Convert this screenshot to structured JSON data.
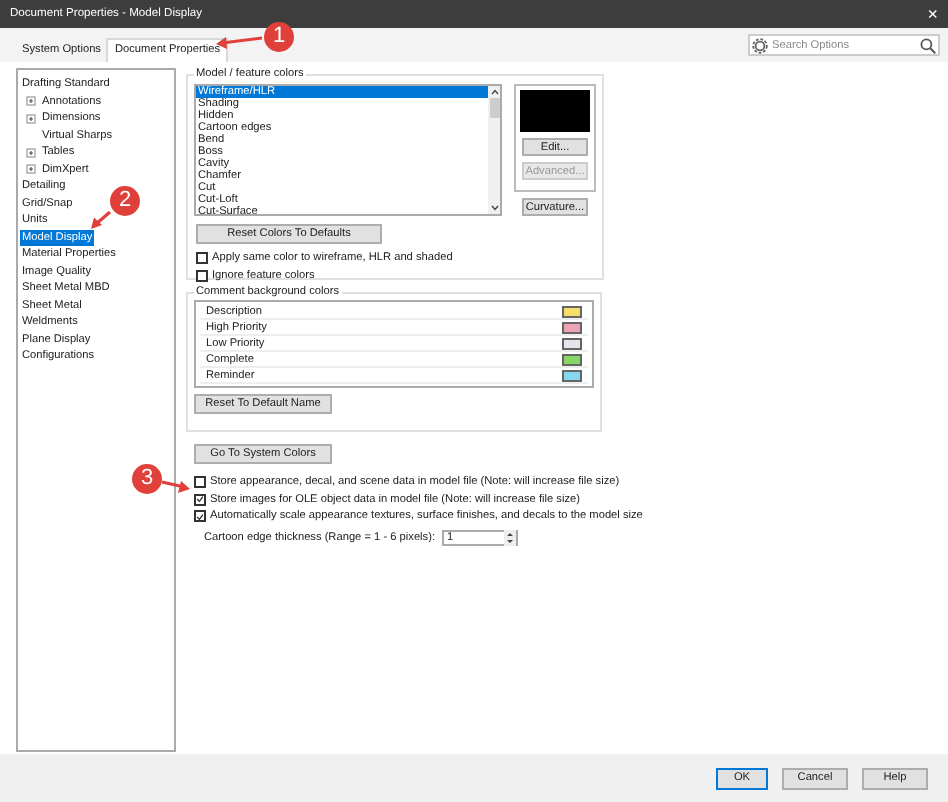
{
  "window": {
    "title": "Document Properties - Model Display",
    "close": "×"
  },
  "tabs": [
    {
      "label": "System Options",
      "selected": false
    },
    {
      "label": "Document Properties",
      "selected": true
    }
  ],
  "search": {
    "placeholder": "Search Options"
  },
  "tree": [
    {
      "label": "Drafting Standard",
      "selected": false,
      "children": [
        {
          "label": "Annotations",
          "selected": false,
          "expanded": false
        },
        {
          "label": "Dimensions",
          "selected": false,
          "expanded": false
        },
        {
          "label": "Virtual Sharps",
          "selected": false
        },
        {
          "label": "Tables",
          "selected": false,
          "expanded": false
        },
        {
          "label": "DimXpert",
          "selected": false,
          "expanded": false
        }
      ]
    },
    {
      "label": "Detailing",
      "selected": false
    },
    {
      "label": "Grid/Snap",
      "selected": false
    },
    {
      "label": "Units",
      "selected": false
    },
    {
      "label": "Model Display",
      "selected": true
    },
    {
      "label": "Material Properties",
      "selected": false
    },
    {
      "label": "Image Quality",
      "selected": false
    },
    {
      "label": "Sheet Metal MBD",
      "selected": false
    },
    {
      "label": "Sheet Metal",
      "selected": false
    },
    {
      "label": "Weldments",
      "selected": false
    },
    {
      "label": "Plane Display",
      "selected": false
    },
    {
      "label": "Configurations",
      "selected": false
    }
  ],
  "model_colors": {
    "title": "Model / feature colors",
    "items": [
      {
        "label": "Wireframe/HLR",
        "selected": true
      },
      {
        "label": "Shading",
        "selected": false
      },
      {
        "label": "Hidden",
        "selected": false
      },
      {
        "label": "Cartoon edges",
        "selected": false
      },
      {
        "label": "Bend",
        "selected": false
      },
      {
        "label": "Boss",
        "selected": false
      },
      {
        "label": "Cavity",
        "selected": false
      },
      {
        "label": "Chamfer",
        "selected": false
      },
      {
        "label": "Cut",
        "selected": false
      },
      {
        "label": "Cut-Loft",
        "selected": false
      },
      {
        "label": "Cut-Surface",
        "selected": false
      }
    ],
    "side_buttons": [
      {
        "label": "Edit...",
        "disabled": false
      },
      {
        "label": "Advanced...",
        "disabled": true
      }
    ],
    "curvature_button": "Curvature...",
    "reset_button": "Reset Colors To Defaults",
    "checkboxes": [
      {
        "label": "Apply same color to wireframe, HLR and shaded",
        "checked": false
      },
      {
        "label": "Ignore feature colors",
        "checked": false
      }
    ]
  },
  "comment_colors": {
    "title": "Comment background colors",
    "items": [
      {
        "label": "Description",
        "color": "#f5de6a"
      },
      {
        "label": "High Priority",
        "color": "#f0a3b4"
      },
      {
        "label": "Low Priority",
        "color": "#e4e4ec"
      },
      {
        "label": "Complete",
        "color": "#86d866"
      },
      {
        "label": "Reminder",
        "color": "#86d8ec"
      }
    ],
    "button": "Reset To Default Name"
  },
  "system_colors_button": "Go To System Colors",
  "options": [
    {
      "label": "Store appearance, decal, and scene data in model file (Note: will increase file size)",
      "checked": false
    },
    {
      "label": "Store images for OLE object data in model file (Note: will increase file size)",
      "checked": true
    },
    {
      "label": "Automatically scale appearance textures, surface finishes, and decals to the model size",
      "checked": true
    }
  ],
  "thickness": {
    "label": "Cartoon edge thickness (Range = 1 - 6 pixels):",
    "value": "1"
  },
  "footer_buttons": [
    {
      "label": "OK",
      "default": true
    },
    {
      "label": "Cancel",
      "default": false
    },
    {
      "label": "Help",
      "default": false
    }
  ],
  "callouts": [
    "1",
    "2",
    "3"
  ]
}
